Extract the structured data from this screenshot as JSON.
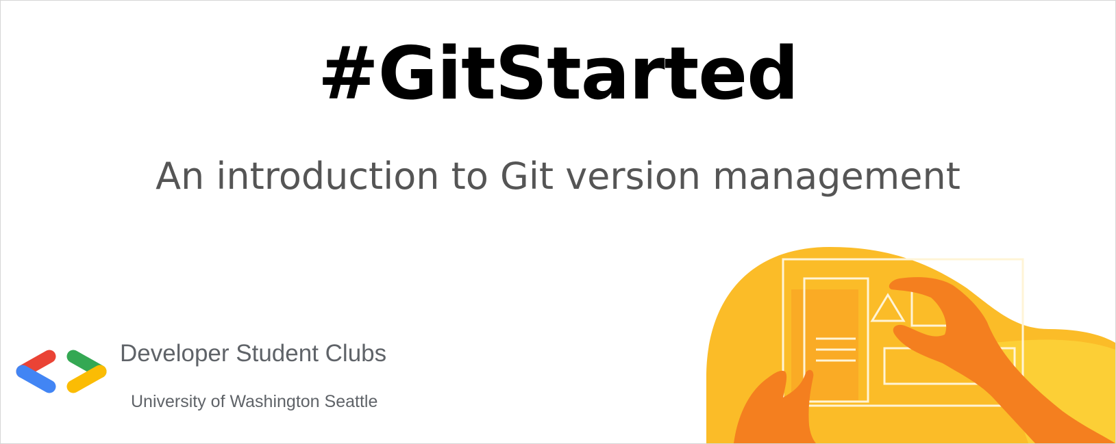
{
  "slide": {
    "title": "#GitStarted",
    "subtitle": "An introduction to Git version management"
  },
  "branding": {
    "org_name": "Developer Student Clubs",
    "chapter": "University of Washington Seattle",
    "logo_colors": {
      "red": "#ea4335",
      "blue": "#4285f4",
      "green": "#34a853",
      "yellow": "#fbbc04"
    }
  },
  "illustration": {
    "icon": "hand-holding-ui-shapes-illustration",
    "colors": {
      "blob": "#fbbc28",
      "panel": "#f9a825",
      "hand": "#f47f1f",
      "lines": "#fff4d6"
    }
  }
}
